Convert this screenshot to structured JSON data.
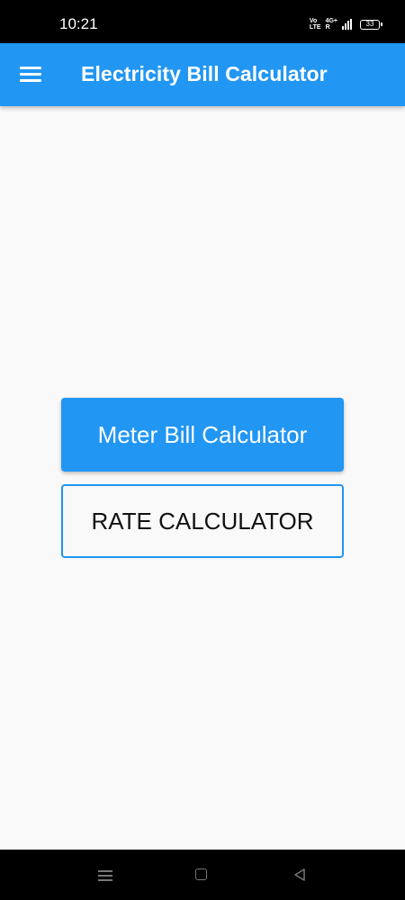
{
  "status_bar": {
    "time": "10:21",
    "volte_top": "Vo",
    "volte_bottom": "LTE",
    "network_top": "4G+",
    "network_bottom": "R",
    "battery_level": "33"
  },
  "app_bar": {
    "title": "Electricity Bill Calculator",
    "menu_icon": "hamburger-menu-icon",
    "color": "#2196f3"
  },
  "main": {
    "meter_button_label": "Meter Bill Calculator",
    "rate_button_label": "RATE CALCULATOR"
  },
  "nav_bar": {
    "icons": [
      "recent-apps-icon",
      "home-icon",
      "back-icon"
    ]
  }
}
